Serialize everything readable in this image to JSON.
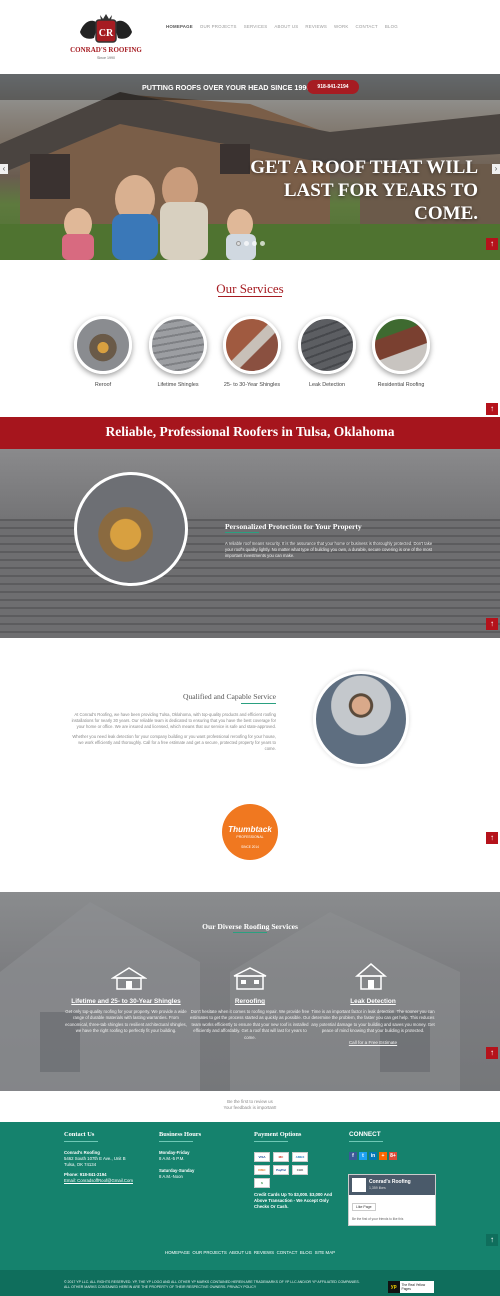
{
  "header": {
    "logo_text": "CONRAD'S ROOFING",
    "logo_since": "Since 1990",
    "nav": [
      "HOMEPAGE",
      "OUR PROJECTS",
      "SERVICES",
      "ABOUT US",
      "REVIEWS",
      "WORK",
      "CONTACT",
      "BLOG"
    ]
  },
  "hero": {
    "tagline": "PUTTING ROOFS OVER YOUR HEAD SINCE 1990",
    "phone": "918-841-2194",
    "headline_1": "GET A ROOF THAT WILL",
    "headline_2": "LAST FOR YEARS TO COME.",
    "prev": "‹",
    "next": "›"
  },
  "services": {
    "title": "Our Services",
    "items": [
      {
        "label": "Reroof"
      },
      {
        "label": "Lifetime Shingles"
      },
      {
        "label": "25- to 30-Year Shingles"
      },
      {
        "label": "Leak Detection"
      },
      {
        "label": "Residential Roofing"
      }
    ]
  },
  "band": {
    "text": "Reliable, Professional Roofers in Tulsa, Oklahoma"
  },
  "protection": {
    "heading": "Personalized Protection for Your Property",
    "text": "A reliable roof means security. It is the assurance that your home or business is thoroughly protected. Don't take your roof's quality lightly. No matter what type of building you own, a durable, secure covering is one of the most important investments you can make."
  },
  "qualified": {
    "heading": "Qualified and Capable Service",
    "p1": "At Conrad's Roofing, we have been providing Tulsa, Oklahoma, with top-quality products and efficient roofing installations for nearly 30 years. Our reliable team is dedicated to ensuring that you have the best coverage for your home or office. We are insured and licensed, which means that our service is safe and state-approved.",
    "p2": "Whether you need leak detection for your company building or you want professional reroofing for your house, we work efficiently and thoroughly. Call for a free estimate and get a secure, protected property for years to come."
  },
  "badge": {
    "title": "Thumbtack",
    "sub": "PROFESSIONAL",
    "year": "SINCE 2014"
  },
  "diverse": {
    "heading": "Our Diverse Roofing Services",
    "cols": [
      {
        "title": "Lifetime and 25- to 30-Year Shingles",
        "text": "Get only top-quality roofing for your property. We provide a wide range of durable materials with lasting warranties. From economical, three-tab shingles to resilient architectural shingles, we have the right roofing to perfectly fit your building."
      },
      {
        "title": "Reroofing",
        "text": "Don't hesitate when it comes to roofing repair. We provide free estimates to get the process started as quickly as possible. Our team works efficiently to ensure that your new roof is installed efficiently and affordably. Get a roof that will last for years to come."
      },
      {
        "title": "Leak Detection",
        "text": "Time is an important factor in leak detection. The sooner you can determine the problem, the faster you can get help. This reduces any potential damage to your building and saves you money. Get peace of mind knowing that your building is protected.",
        "link": "Call for a Free Estimate"
      }
    ]
  },
  "review": {
    "line1": "Be the first to review us",
    "line2": "Your feedback is important!"
  },
  "footer": {
    "contact": {
      "heading": "Contact Us",
      "name": "Conrad's Roofing",
      "addr1": "5462 South 107th E Ave., Unit B",
      "addr2": "Tulsa, OK 74134",
      "phone": "Phone: 918-841-2194",
      "email": "Email: ConradsoffRoof@Gmail.Com"
    },
    "hours": {
      "heading": "Business Hours",
      "d1": "Monday-Friday",
      "t1": "8 A.M.-5 P.M.",
      "d2": "Saturday-Sunday",
      "t2": "8 A.M.-Noon"
    },
    "payment": {
      "heading": "Payment Options",
      "cards": [
        "VISA",
        "MC",
        "AMEX",
        "DISC",
        "PayPal",
        "CHK",
        "$"
      ],
      "note": "Credit Cards Up To $3,000. $3,000 And Above Transaction - We Accept Only Checks Or Cash."
    },
    "connect": {
      "heading": "CONNECT",
      "social": [
        "f",
        "t",
        "in",
        "+",
        "8+"
      ],
      "fb_name": "Conrad's Roofing",
      "fb_likes": "1,359 likes",
      "fb_like": "Like Page",
      "fb_post": "Be the first of your friends to like this"
    },
    "nav": [
      "HOMEPAGE",
      "OUR PROJECTS",
      "ABOUT US",
      "REVIEWS",
      "CONTACT",
      "BLOG",
      "SITE MAP"
    ],
    "copyright": "© 2017 YP LLC. ALL RIGHTS RESERVED. YP, THE YP LOGO AND ALL OTHER YP MARKS CONTAINED HEREIN ARE TRADEMARKS OF YP LLC AND/OR YP AFFILIATED COMPANIES. ALL OTHER MARKS CONTAINED HEREIN ARE THE PROPERTY OF THEIR RESPECTIVE OWNERS. PRIVACY POLICY",
    "yp_logo": "yp",
    "yp_text": "The Real Yellow Pages"
  },
  "back_to_top": "↑",
  "colors": {
    "brand_red": "#a6151d",
    "teal": "#15826d"
  }
}
